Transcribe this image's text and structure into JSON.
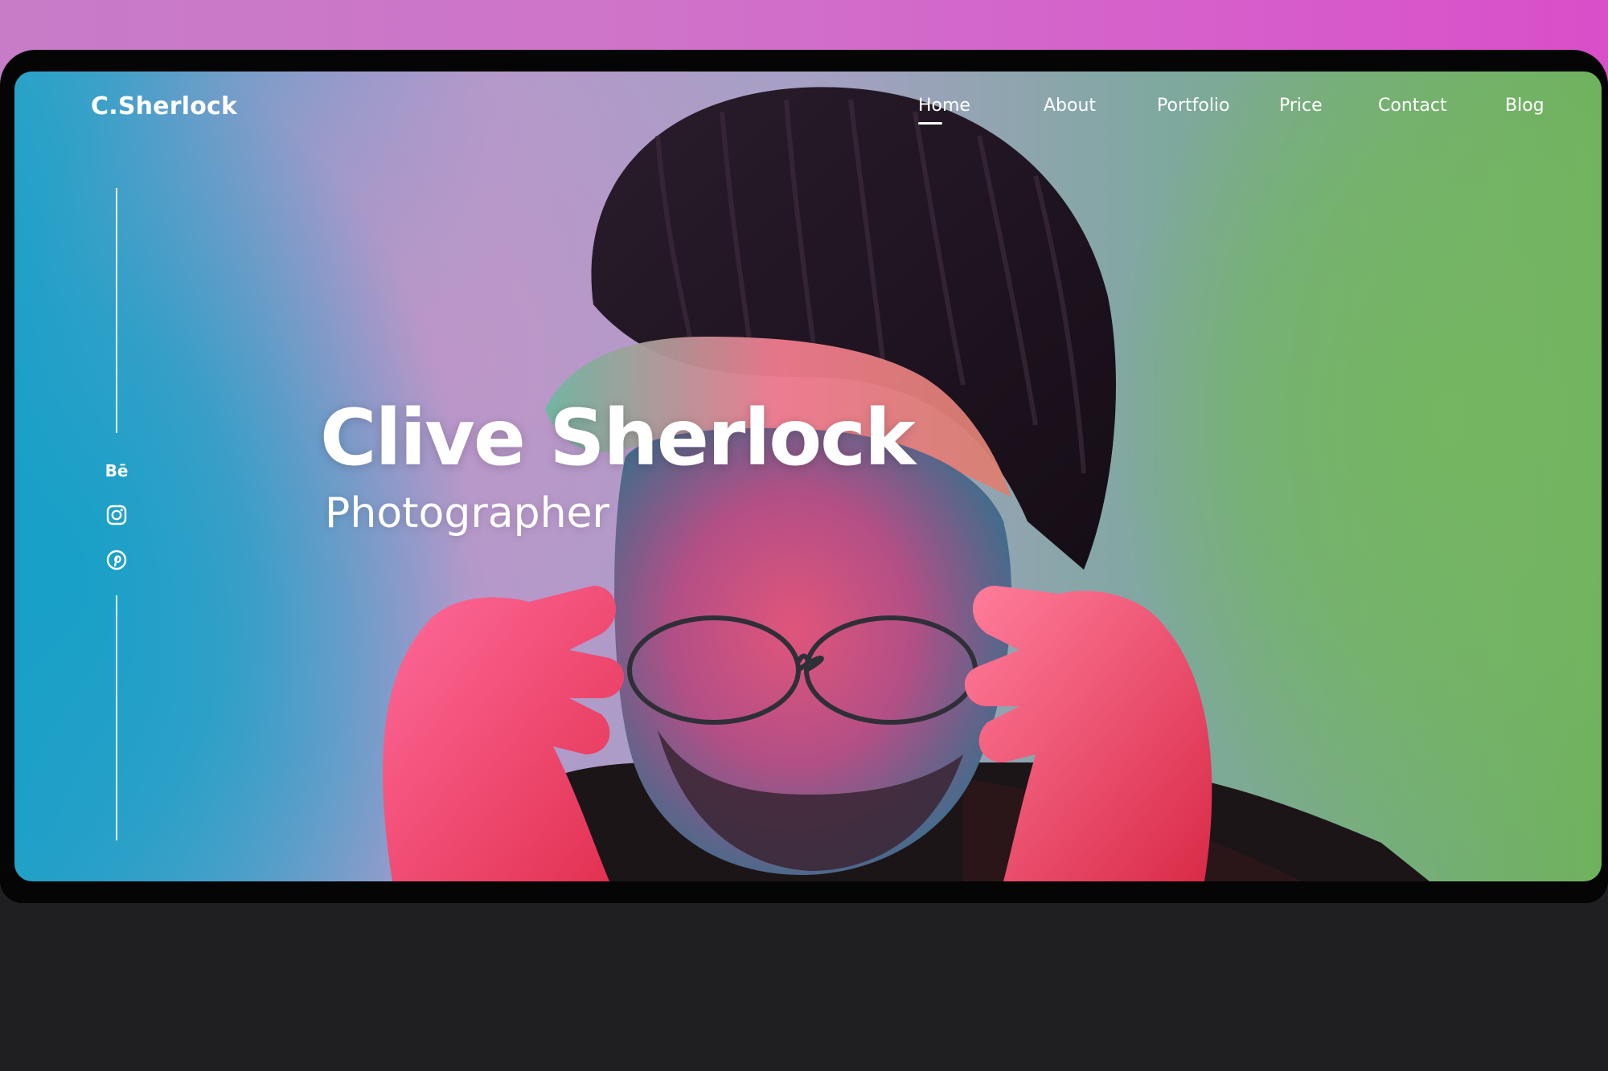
{
  "site": {
    "brand": "C.Sherlock"
  },
  "nav": {
    "items": [
      {
        "label": "Home",
        "active": true
      },
      {
        "label": "About"
      },
      {
        "label": "Portfolio"
      },
      {
        "label": "Price"
      },
      {
        "label": "Contact"
      },
      {
        "label": "Blog"
      }
    ]
  },
  "social": {
    "behance_label": "Bē",
    "icons": [
      "behance-icon",
      "instagram-icon",
      "pinterest-icon"
    ]
  },
  "hero": {
    "name": "Clive Sherlock",
    "role": "Photographer"
  },
  "colors": {
    "backdrop_pink": "#d65fcb",
    "frame": "#050505",
    "page_dark": "#1f1e21",
    "text": "#ffffff",
    "green": "#6fb25c",
    "cyan": "#2aa2c8"
  }
}
